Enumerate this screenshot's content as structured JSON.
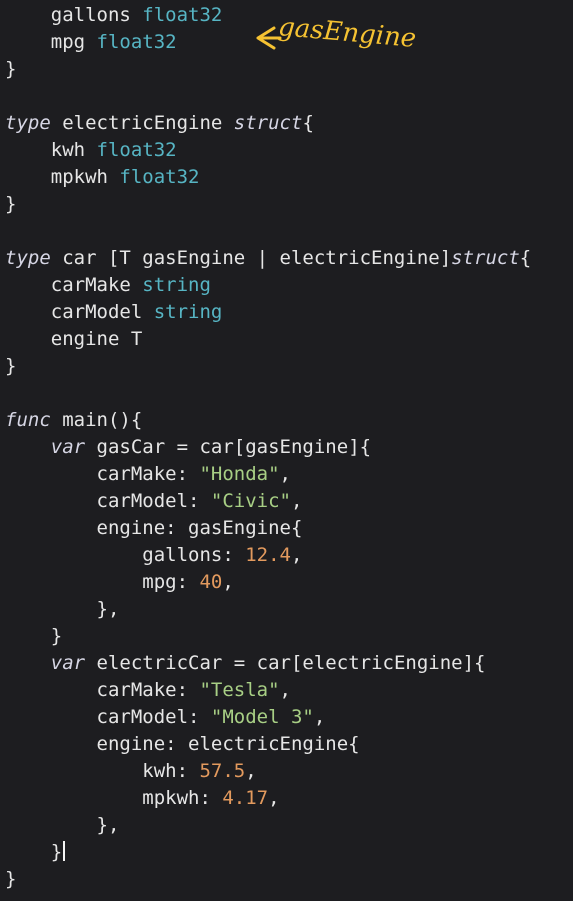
{
  "annotation": {
    "text": "gasEngine",
    "color": "#f5c232",
    "icon": "arrow-left-icon"
  },
  "code": {
    "lines": [
      {
        "ind": "    ",
        "t": [
          {
            "v": "gallons "
          },
          {
            "v": "float32",
            "c": "tp"
          }
        ]
      },
      {
        "ind": "    ",
        "t": [
          {
            "v": "mpg "
          },
          {
            "v": "float32",
            "c": "tp"
          }
        ]
      },
      {
        "ind": "",
        "t": [
          {
            "v": "}"
          }
        ]
      },
      {
        "ind": "",
        "t": []
      },
      {
        "ind": "",
        "t": [
          {
            "v": "type",
            "c": "kw"
          },
          {
            "v": " electricEngine "
          },
          {
            "v": "struct",
            "c": "kw"
          },
          {
            "v": "{"
          }
        ]
      },
      {
        "ind": "    ",
        "t": [
          {
            "v": "kwh "
          },
          {
            "v": "float32",
            "c": "tp"
          }
        ]
      },
      {
        "ind": "    ",
        "t": [
          {
            "v": "mpkwh "
          },
          {
            "v": "float32",
            "c": "tp"
          }
        ]
      },
      {
        "ind": "",
        "t": [
          {
            "v": "}"
          }
        ]
      },
      {
        "ind": "",
        "t": []
      },
      {
        "ind": "",
        "t": [
          {
            "v": "type",
            "c": "kw"
          },
          {
            "v": " car [T gasEngine | electricEngine]"
          },
          {
            "v": "struct",
            "c": "kw"
          },
          {
            "v": "{"
          }
        ]
      },
      {
        "ind": "    ",
        "t": [
          {
            "v": "carMake "
          },
          {
            "v": "string",
            "c": "tp"
          }
        ]
      },
      {
        "ind": "    ",
        "t": [
          {
            "v": "carModel "
          },
          {
            "v": "string",
            "c": "tp"
          }
        ]
      },
      {
        "ind": "    ",
        "t": [
          {
            "v": "engine T"
          }
        ]
      },
      {
        "ind": "",
        "t": [
          {
            "v": "}"
          }
        ]
      },
      {
        "ind": "",
        "t": []
      },
      {
        "ind": "",
        "t": [
          {
            "v": "func",
            "c": "kw"
          },
          {
            "v": " main(){"
          }
        ]
      },
      {
        "ind": "    ",
        "t": [
          {
            "v": "var",
            "c": "kw"
          },
          {
            "v": " gasCar = car[gasEngine]{"
          }
        ]
      },
      {
        "ind": "        ",
        "t": [
          {
            "v": "carMake: "
          },
          {
            "v": "\"Honda\"",
            "c": "str"
          },
          {
            "v": ","
          }
        ]
      },
      {
        "ind": "        ",
        "t": [
          {
            "v": "carModel: "
          },
          {
            "v": "\"Civic\"",
            "c": "str"
          },
          {
            "v": ","
          }
        ]
      },
      {
        "ind": "        ",
        "t": [
          {
            "v": "engine: gasEngine{"
          }
        ]
      },
      {
        "ind": "            ",
        "t": [
          {
            "v": "gallons: "
          },
          {
            "v": "12.4",
            "c": "num"
          },
          {
            "v": ","
          }
        ]
      },
      {
        "ind": "            ",
        "t": [
          {
            "v": "mpg: "
          },
          {
            "v": "40",
            "c": "num"
          },
          {
            "v": ","
          }
        ]
      },
      {
        "ind": "        ",
        "t": [
          {
            "v": "},"
          }
        ]
      },
      {
        "ind": "    ",
        "t": [
          {
            "v": "}"
          }
        ]
      },
      {
        "ind": "    ",
        "t": [
          {
            "v": "var",
            "c": "kw"
          },
          {
            "v": " electricCar = car[electricEngine]{"
          }
        ]
      },
      {
        "ind": "        ",
        "t": [
          {
            "v": "carMake: "
          },
          {
            "v": "\"Tesla\"",
            "c": "str"
          },
          {
            "v": ","
          }
        ]
      },
      {
        "ind": "        ",
        "t": [
          {
            "v": "carModel: "
          },
          {
            "v": "\"Model 3\"",
            "c": "str"
          },
          {
            "v": ","
          }
        ]
      },
      {
        "ind": "        ",
        "t": [
          {
            "v": "engine: electricEngine{"
          }
        ]
      },
      {
        "ind": "            ",
        "t": [
          {
            "v": "kwh: "
          },
          {
            "v": "57.5",
            "c": "num"
          },
          {
            "v": ","
          }
        ]
      },
      {
        "ind": "            ",
        "t": [
          {
            "v": "mpkwh: "
          },
          {
            "v": "4.17",
            "c": "num"
          },
          {
            "v": ","
          }
        ]
      },
      {
        "ind": "        ",
        "t": [
          {
            "v": "},"
          }
        ]
      },
      {
        "ind": "    ",
        "t": [
          {
            "v": "}"
          }
        ],
        "cursor": true
      },
      {
        "ind": "",
        "t": [
          {
            "v": "}"
          }
        ]
      }
    ]
  },
  "colors": {
    "background": "#1d1d20",
    "text": "#e6e6e6",
    "keyword": "#d6d6e4",
    "type": "#57b5c4",
    "string": "#a8cf85",
    "number": "#e39a5e"
  }
}
